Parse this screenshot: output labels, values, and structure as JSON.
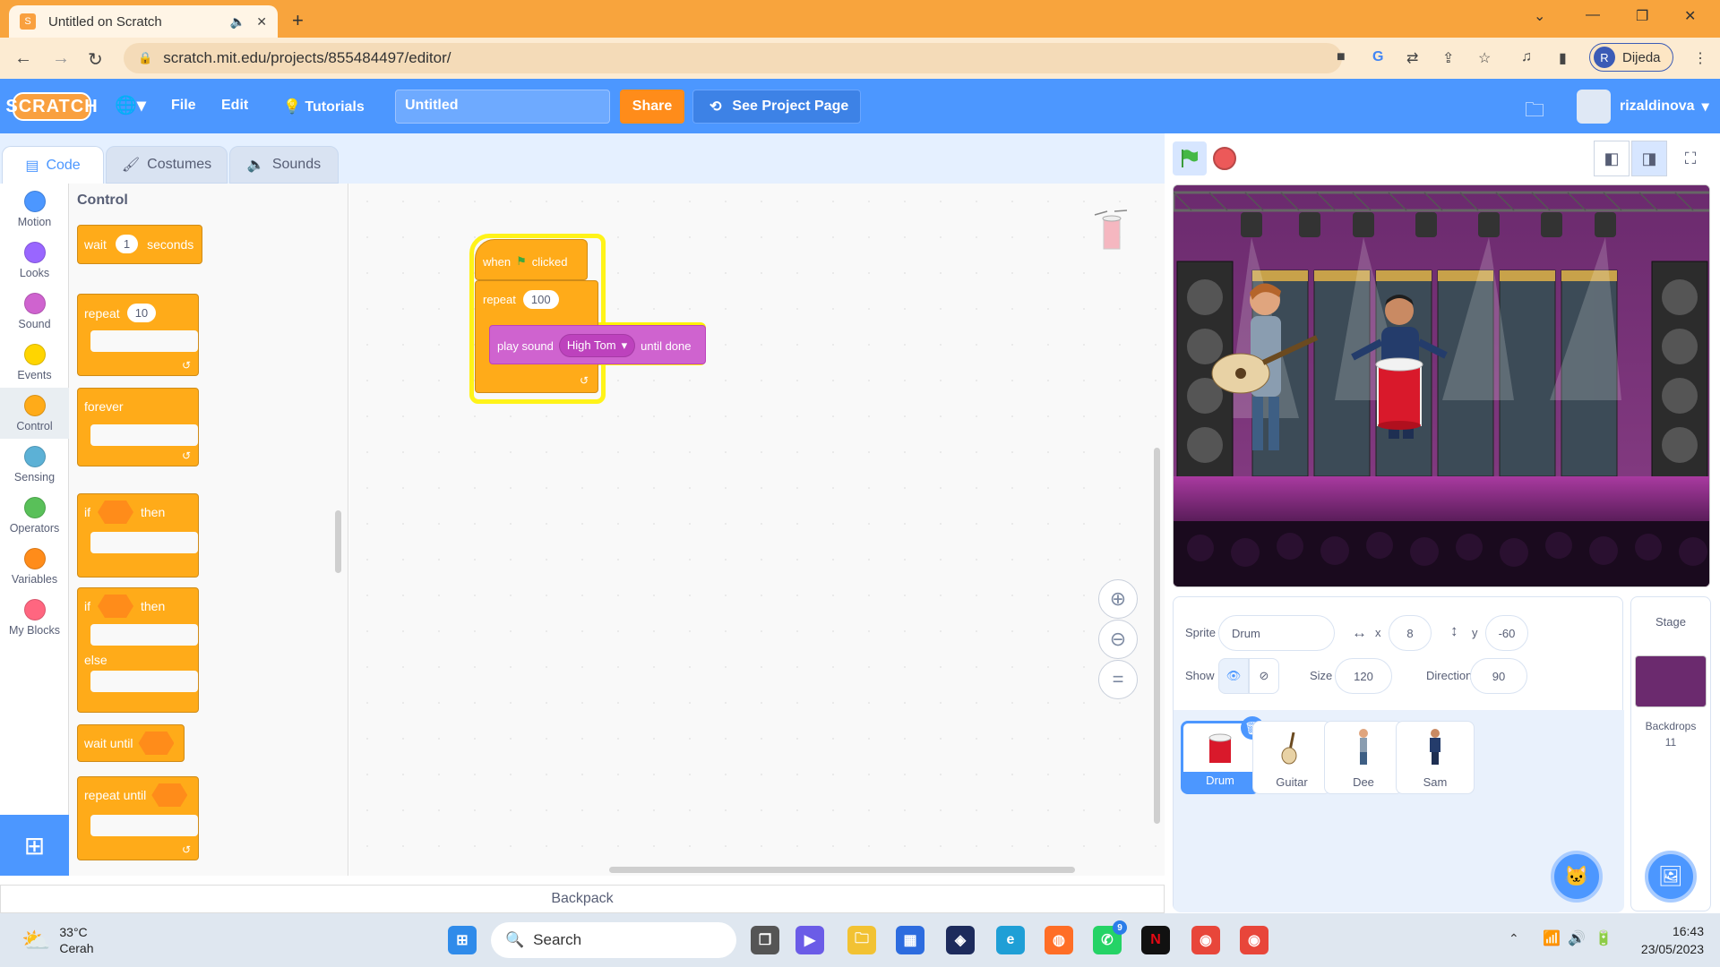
{
  "browser": {
    "tab_title": "Untitled on Scratch",
    "new_tab": "+",
    "url": "scratch.mit.edu/projects/855484497/editor/",
    "profile_initial": "R",
    "profile_name": "Dijeda"
  },
  "menubar": {
    "logo": "SCRATCH",
    "file": "File",
    "edit": "Edit",
    "tutorials": "Tutorials",
    "project_title": "Untitled",
    "share": "Share",
    "see_project_page": "See Project Page",
    "username": "rizaldinova"
  },
  "editor_tabs": [
    "Code",
    "Costumes",
    "Sounds"
  ],
  "categories": [
    {
      "label": "Motion",
      "color": "#4c97ff"
    },
    {
      "label": "Looks",
      "color": "#9966ff"
    },
    {
      "label": "Sound",
      "color": "#cf63cf"
    },
    {
      "label": "Events",
      "color": "#ffd500"
    },
    {
      "label": "Control",
      "color": "#ffab19"
    },
    {
      "label": "Sensing",
      "color": "#5cb1d6"
    },
    {
      "label": "Operators",
      "color": "#59c059"
    },
    {
      "label": "Variables",
      "color": "#ff8c1a"
    },
    {
      "label": "My Blocks",
      "color": "#ff6680"
    }
  ],
  "palette": {
    "title": "Control",
    "wait": "wait",
    "wait_val": "1",
    "seconds": "seconds",
    "repeat": "repeat",
    "repeat_val": "10",
    "forever": "forever",
    "if": "if",
    "then": "then",
    "else": "else",
    "wait_until": "wait until",
    "repeat_until": "repeat until"
  },
  "script": {
    "when": "when",
    "clicked": "clicked",
    "repeat": "repeat",
    "repeat_val": "100",
    "play_sound": "play sound",
    "sound_name": "High Tom",
    "until_done": "until done"
  },
  "backpack": "Backpack",
  "sprite_info": {
    "sprite_label": "Sprite",
    "sprite_name": "Drum",
    "x_label": "x",
    "x": "8",
    "y_label": "y",
    "y": "-60",
    "show_label": "Show",
    "size_label": "Size",
    "size": "120",
    "direction_label": "Direction",
    "direction": "90"
  },
  "sprites": [
    "Drum",
    "Guitar",
    "Dee",
    "Sam"
  ],
  "stage_panel": {
    "title": "Stage",
    "backdrops_label": "Backdrops",
    "backdrops_count": "11"
  },
  "taskbar": {
    "temp": "33°C",
    "weather": "Cerah",
    "search": "Search",
    "time": "16:43",
    "date": "23/05/2023",
    "whatsapp_badge": "9"
  }
}
